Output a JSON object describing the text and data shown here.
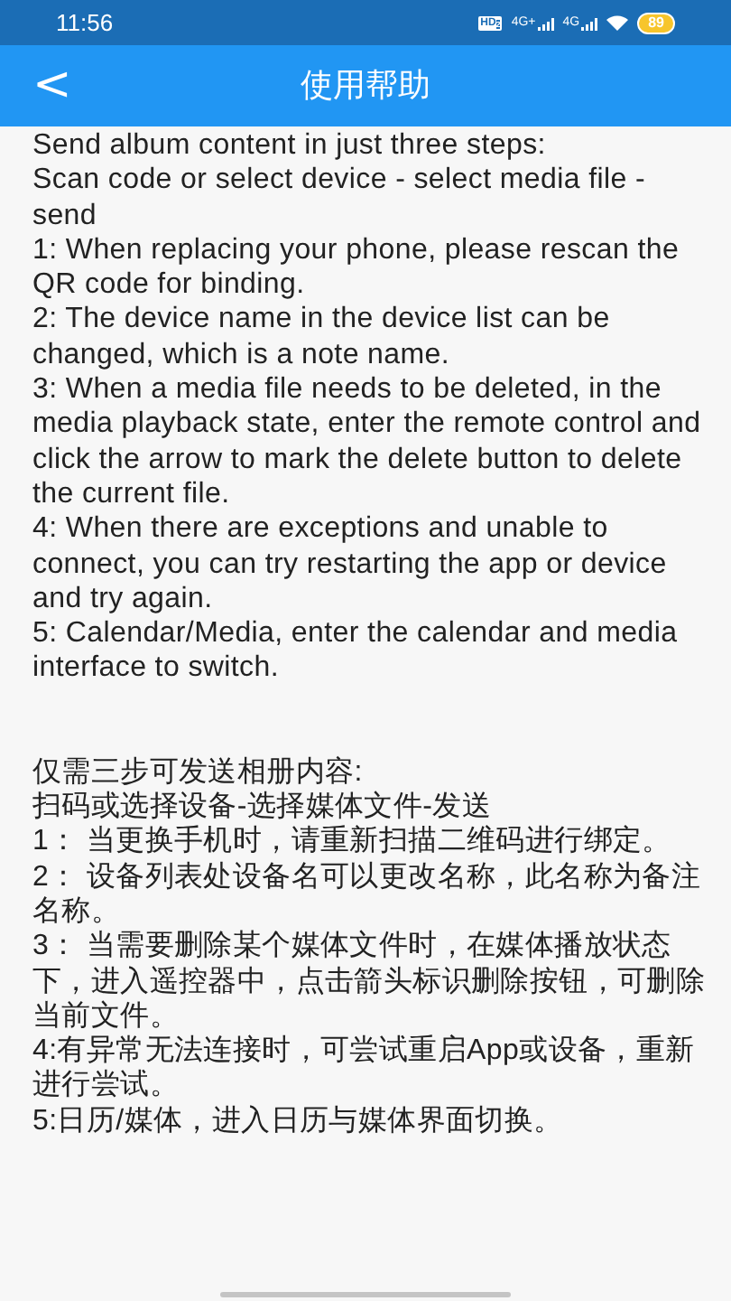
{
  "status_bar": {
    "time": "11:56",
    "hd": "HD",
    "hd_sub": "2",
    "networks": [
      "4G+",
      "4G"
    ],
    "battery": "89"
  },
  "header": {
    "back": "<",
    "title": "使用帮助"
  },
  "sections": [
    {
      "lines": [
        "Send album content in just three steps:",
        "Scan code or select device - select media file - send",
        "1: When replacing your phone, please rescan the QR code for binding.",
        "2: The device name in the device list can be changed, which is a note name.",
        "3: When a media file needs to be deleted, in the media playback state, enter the remote control and click the arrow to mark the delete button to delete the current file.",
        "4: When there are exceptions and unable to connect, you can try restarting the app or device and try again.",
        "5: Calendar/Media, enter the calendar and media interface to switch."
      ]
    },
    {
      "lines": [
        "仅需三步可发送相册内容:",
        "扫码或选择设备-选择媒体文件-发送",
        "1： 当更换手机时，请重新扫描二维码进行绑定。",
        "2： 设备列表处设备名可以更改名称，此名称为备注名称。",
        "3： 当需要删除某个媒体文件时，在媒体播放状态下，进入遥控器中，点击箭头标识删除按钮，可删除当前文件。",
        "4:有异常无法连接时，可尝试重启App或设备，重新进行尝试。",
        "5:日历/媒体，进入日历与媒体界面切换。"
      ]
    }
  ]
}
